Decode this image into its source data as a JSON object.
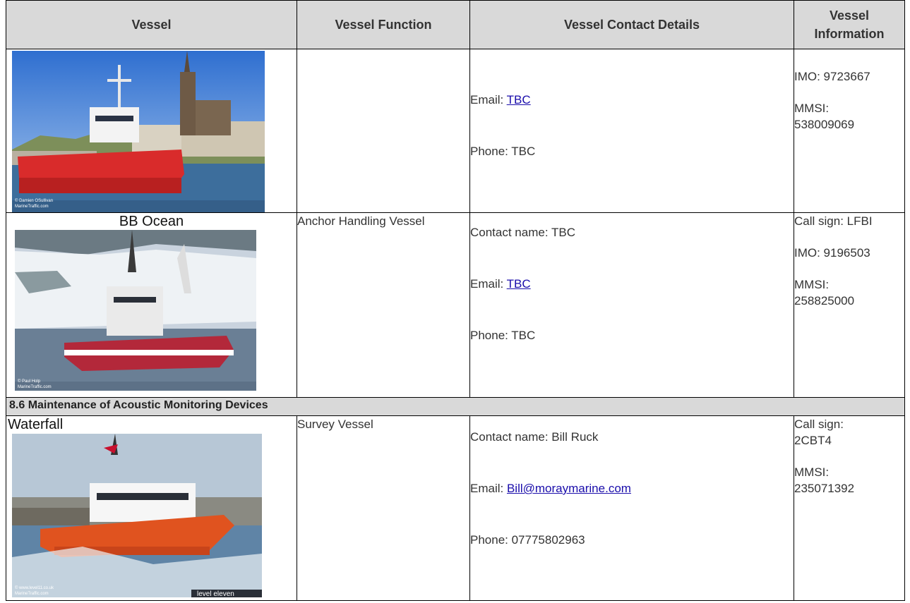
{
  "headers": {
    "vessel": "Vessel",
    "function": "Vessel Function",
    "contact": "Vessel Contact Details",
    "info": "Vessel Information"
  },
  "row1": {
    "email_label": "Email: ",
    "email_link": "TBC",
    "phone": "Phone: TBC",
    "imo": "IMO: 9723667",
    "mmsi_label": "MMSI:",
    "mmsi_value": "538009069",
    "photo_credit_1": "© Damien OSullivan",
    "photo_credit_2": "MarineTraffic.com"
  },
  "row2": {
    "name": "BB Ocean",
    "function": "Anchor Handling Vessel",
    "contact_name": "Contact name: TBC",
    "email_label": "Email: ",
    "email_link": "TBC",
    "phone": "Phone: TBC",
    "call_sign": "Call sign: LFBI",
    "imo": "IMO: 9196503",
    "mmsi_label": "MMSI:",
    "mmsi_value": "258825000",
    "photo_credit_1": "© Paul Holp",
    "photo_credit_2": "MarineTraffic.com"
  },
  "section": {
    "title": "8.6 Maintenance of Acoustic Monitoring Devices"
  },
  "row3": {
    "name": "Waterfall",
    "function": "Survey Vessel",
    "contact_name": "Contact name: Bill Ruck",
    "email_label": "Email: ",
    "email_link": "Bill@moraymarine.com",
    "phone": "Phone: 07775802963",
    "call_sign_label": "Call sign:",
    "call_sign_value": "2CBT4",
    "mmsi_label": "MMSI:",
    "mmsi_value": "235071392",
    "photo_credit_1": "© www.level11.co.uk",
    "photo_credit_2": "MarineTraffic.com",
    "photo_watermark": "level eleven"
  },
  "colors": {
    "header_bg": "#d9d9d9",
    "link": "#1a0dab",
    "hull_red": "#d92b2b"
  }
}
